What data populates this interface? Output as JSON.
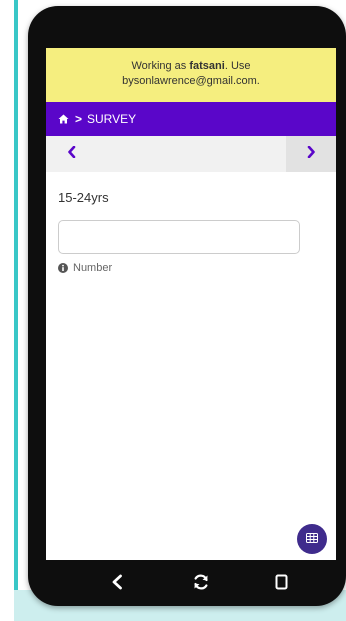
{
  "banner": {
    "prefix": "Working as ",
    "username": "fatsani",
    "suffix": ". Use",
    "email_line": "bysonlawrence@gmail.com."
  },
  "breadcrumb": {
    "home_icon": "home-icon",
    "separator": ">",
    "current": "SURVEY"
  },
  "pager": {
    "prev_icon": "chevron-left-icon",
    "next_icon": "chevron-right-icon"
  },
  "question": {
    "label": "15-24yrs",
    "value": "",
    "hint": "Number",
    "hint_icon": "info-icon"
  },
  "fab": {
    "icon": "grid-icon"
  },
  "system_nav": {
    "back_icon": "back-icon",
    "refresh_icon": "refresh-icon",
    "recents_icon": "recents-icon"
  },
  "colors": {
    "banner_bg": "#f5ee7f",
    "navbar_bg": "#5a06c9",
    "accent": "#5a06c9",
    "fab_bg": "#3f2b8c",
    "device_frame": "#0e0e0e"
  }
}
